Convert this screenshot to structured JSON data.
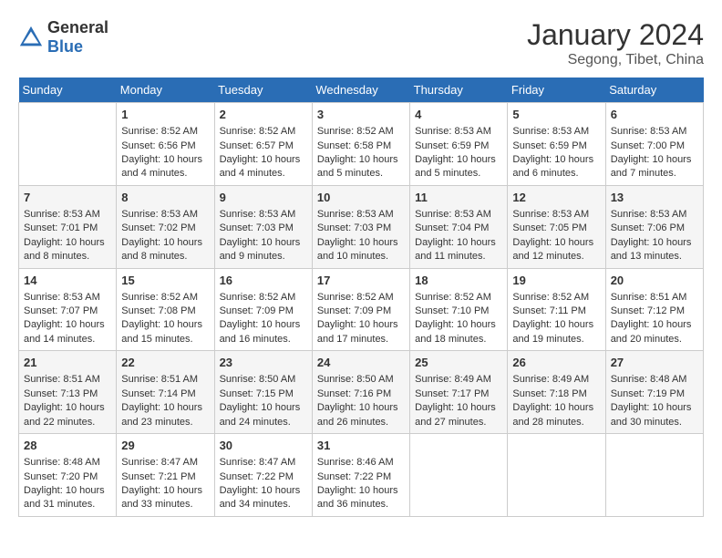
{
  "header": {
    "logo_line1": "General",
    "logo_line2": "Blue",
    "main_title": "January 2024",
    "subtitle": "Segong, Tibet, China"
  },
  "days_of_week": [
    "Sunday",
    "Monday",
    "Tuesday",
    "Wednesday",
    "Thursday",
    "Friday",
    "Saturday"
  ],
  "weeks": [
    [
      {
        "day": "",
        "info": ""
      },
      {
        "day": "1",
        "info": "Sunrise: 8:52 AM\nSunset: 6:56 PM\nDaylight: 10 hours\nand 4 minutes."
      },
      {
        "day": "2",
        "info": "Sunrise: 8:52 AM\nSunset: 6:57 PM\nDaylight: 10 hours\nand 4 minutes."
      },
      {
        "day": "3",
        "info": "Sunrise: 8:52 AM\nSunset: 6:58 PM\nDaylight: 10 hours\nand 5 minutes."
      },
      {
        "day": "4",
        "info": "Sunrise: 8:53 AM\nSunset: 6:59 PM\nDaylight: 10 hours\nand 5 minutes."
      },
      {
        "day": "5",
        "info": "Sunrise: 8:53 AM\nSunset: 6:59 PM\nDaylight: 10 hours\nand 6 minutes."
      },
      {
        "day": "6",
        "info": "Sunrise: 8:53 AM\nSunset: 7:00 PM\nDaylight: 10 hours\nand 7 minutes."
      }
    ],
    [
      {
        "day": "7",
        "info": "Sunrise: 8:53 AM\nSunset: 7:01 PM\nDaylight: 10 hours\nand 8 minutes."
      },
      {
        "day": "8",
        "info": "Sunrise: 8:53 AM\nSunset: 7:02 PM\nDaylight: 10 hours\nand 8 minutes."
      },
      {
        "day": "9",
        "info": "Sunrise: 8:53 AM\nSunset: 7:03 PM\nDaylight: 10 hours\nand 9 minutes."
      },
      {
        "day": "10",
        "info": "Sunrise: 8:53 AM\nSunset: 7:03 PM\nDaylight: 10 hours\nand 10 minutes."
      },
      {
        "day": "11",
        "info": "Sunrise: 8:53 AM\nSunset: 7:04 PM\nDaylight: 10 hours\nand 11 minutes."
      },
      {
        "day": "12",
        "info": "Sunrise: 8:53 AM\nSunset: 7:05 PM\nDaylight: 10 hours\nand 12 minutes."
      },
      {
        "day": "13",
        "info": "Sunrise: 8:53 AM\nSunset: 7:06 PM\nDaylight: 10 hours\nand 13 minutes."
      }
    ],
    [
      {
        "day": "14",
        "info": "Sunrise: 8:53 AM\nSunset: 7:07 PM\nDaylight: 10 hours\nand 14 minutes."
      },
      {
        "day": "15",
        "info": "Sunrise: 8:52 AM\nSunset: 7:08 PM\nDaylight: 10 hours\nand 15 minutes."
      },
      {
        "day": "16",
        "info": "Sunrise: 8:52 AM\nSunset: 7:09 PM\nDaylight: 10 hours\nand 16 minutes."
      },
      {
        "day": "17",
        "info": "Sunrise: 8:52 AM\nSunset: 7:09 PM\nDaylight: 10 hours\nand 17 minutes."
      },
      {
        "day": "18",
        "info": "Sunrise: 8:52 AM\nSunset: 7:10 PM\nDaylight: 10 hours\nand 18 minutes."
      },
      {
        "day": "19",
        "info": "Sunrise: 8:52 AM\nSunset: 7:11 PM\nDaylight: 10 hours\nand 19 minutes."
      },
      {
        "day": "20",
        "info": "Sunrise: 8:51 AM\nSunset: 7:12 PM\nDaylight: 10 hours\nand 20 minutes."
      }
    ],
    [
      {
        "day": "21",
        "info": "Sunrise: 8:51 AM\nSunset: 7:13 PM\nDaylight: 10 hours\nand 22 minutes."
      },
      {
        "day": "22",
        "info": "Sunrise: 8:51 AM\nSunset: 7:14 PM\nDaylight: 10 hours\nand 23 minutes."
      },
      {
        "day": "23",
        "info": "Sunrise: 8:50 AM\nSunset: 7:15 PM\nDaylight: 10 hours\nand 24 minutes."
      },
      {
        "day": "24",
        "info": "Sunrise: 8:50 AM\nSunset: 7:16 PM\nDaylight: 10 hours\nand 26 minutes."
      },
      {
        "day": "25",
        "info": "Sunrise: 8:49 AM\nSunset: 7:17 PM\nDaylight: 10 hours\nand 27 minutes."
      },
      {
        "day": "26",
        "info": "Sunrise: 8:49 AM\nSunset: 7:18 PM\nDaylight: 10 hours\nand 28 minutes."
      },
      {
        "day": "27",
        "info": "Sunrise: 8:48 AM\nSunset: 7:19 PM\nDaylight: 10 hours\nand 30 minutes."
      }
    ],
    [
      {
        "day": "28",
        "info": "Sunrise: 8:48 AM\nSunset: 7:20 PM\nDaylight: 10 hours\nand 31 minutes."
      },
      {
        "day": "29",
        "info": "Sunrise: 8:47 AM\nSunset: 7:21 PM\nDaylight: 10 hours\nand 33 minutes."
      },
      {
        "day": "30",
        "info": "Sunrise: 8:47 AM\nSunset: 7:22 PM\nDaylight: 10 hours\nand 34 minutes."
      },
      {
        "day": "31",
        "info": "Sunrise: 8:46 AM\nSunset: 7:22 PM\nDaylight: 10 hours\nand 36 minutes."
      },
      {
        "day": "",
        "info": ""
      },
      {
        "day": "",
        "info": ""
      },
      {
        "day": "",
        "info": ""
      }
    ]
  ]
}
